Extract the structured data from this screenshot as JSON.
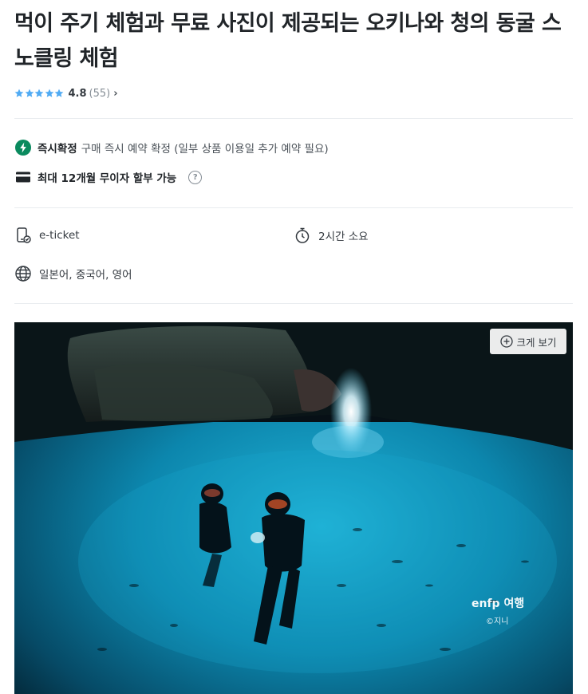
{
  "product": {
    "title": "먹이 주기 체험과 무료 사진이 제공되는 오키나와 청의 동굴 스노클링 체험",
    "rating": {
      "score": "4.8",
      "count": "(55)",
      "stars": 5
    }
  },
  "features": {
    "instant": {
      "label": "즉시확정",
      "desc": "구매 즉시 예약 확정 (일부 상품 이용일 추가 예약 필요)",
      "icon": "lightning-icon",
      "color": "#0a8a5e"
    },
    "installment": {
      "label": "최대 12개월 무이자 할부 가능",
      "help": "?",
      "icon": "card-icon"
    }
  },
  "info": {
    "ticket": {
      "label": "e-ticket",
      "icon": "mobile-ticket-icon"
    },
    "duration": {
      "label": "2시간 소요",
      "icon": "timer-icon"
    },
    "language": {
      "label": "일본어, 중국어, 영어",
      "icon": "globe-icon"
    }
  },
  "photo": {
    "zoom_label": "크게 보기",
    "watermark_main": "enfp 여행",
    "watermark_sub": "©지니"
  },
  "colors": {
    "star": "#51abf3",
    "accent_green": "#0a8a5e",
    "text": "#212529"
  }
}
